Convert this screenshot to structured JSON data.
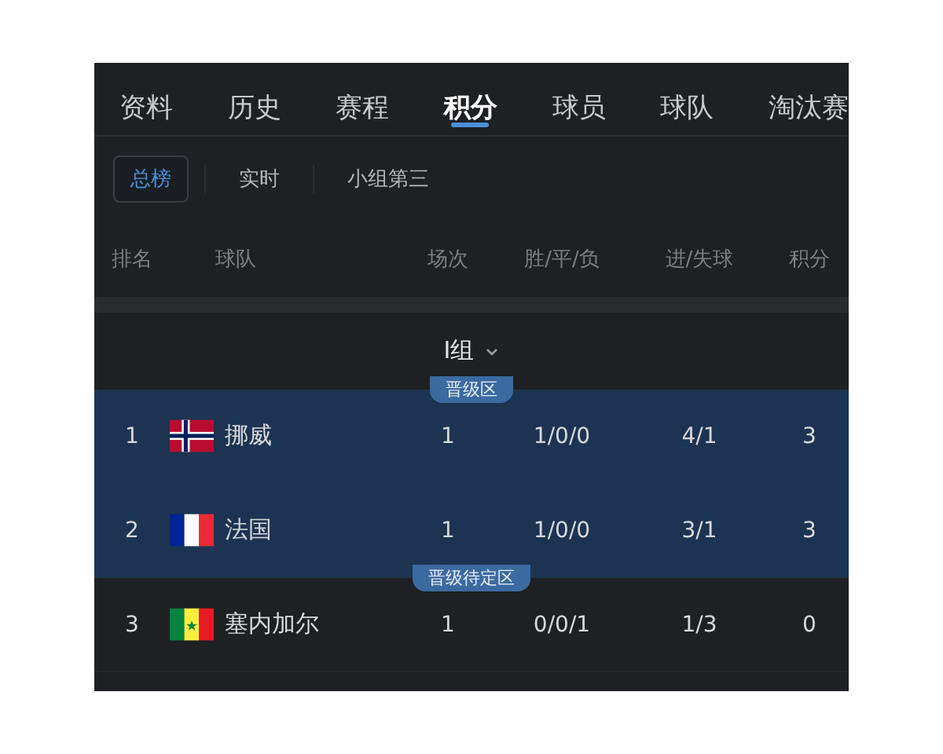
{
  "tabs": [
    {
      "label": "资料",
      "selected": false
    },
    {
      "label": "历史",
      "selected": false
    },
    {
      "label": "赛程",
      "selected": false
    },
    {
      "label": "积分",
      "selected": true
    },
    {
      "label": "球员",
      "selected": false
    },
    {
      "label": "球队",
      "selected": false
    },
    {
      "label": "淘汰赛",
      "selected": false
    }
  ],
  "subtabs": [
    {
      "label": "总榜",
      "selected": true
    },
    {
      "label": "实时",
      "selected": false
    },
    {
      "label": "小组第三",
      "selected": false
    }
  ],
  "table": {
    "columns": [
      "排名",
      "球队",
      "场次",
      "胜/平/负",
      "进/失球",
      "积分"
    ],
    "group": "I组",
    "rows": [
      {
        "rank": "1",
        "kind": "norway",
        "team": "挪威",
        "played": "1",
        "wdl": "1/0/0",
        "goals": "4/1",
        "points": "3",
        "qualified": true,
        "zone": "晋级区"
      },
      {
        "rank": "2",
        "kind": "france",
        "team": "法国",
        "played": "1",
        "wdl": "1/0/0",
        "goals": "3/1",
        "points": "3",
        "qualified": true
      },
      {
        "rank": "3",
        "kind": "senegal",
        "team": "塞内加尔",
        "played": "1",
        "wdl": "0/0/1",
        "goals": "1/3",
        "points": "0",
        "qualified": false,
        "zone": "晋级待定区"
      }
    ]
  }
}
